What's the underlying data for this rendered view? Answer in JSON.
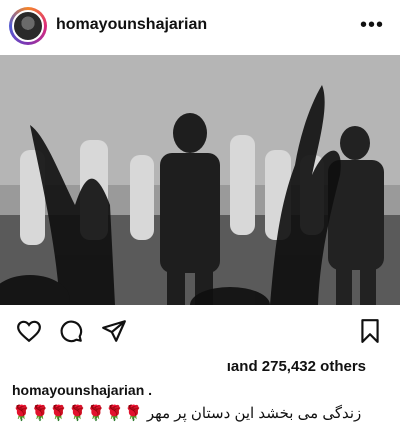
{
  "header": {
    "username": "homayounshajarian",
    "more_label": "•••"
  },
  "actions": {
    "like_icon": "heart-icon",
    "comment_icon": "comment-icon",
    "share_icon": "paper-plane-icon",
    "save_icon": "bookmark-icon"
  },
  "likes": {
    "text": "ıand 275,432 others"
  },
  "caption": {
    "username": "homayounshajarian .",
    "text": "زندگی می بخشد این دستان پر مهر 🌹🌹🌹🌹🌹🌹🌹"
  },
  "colors": {
    "story_ring": "#dd2a7b",
    "photo_tone": "#777777"
  }
}
